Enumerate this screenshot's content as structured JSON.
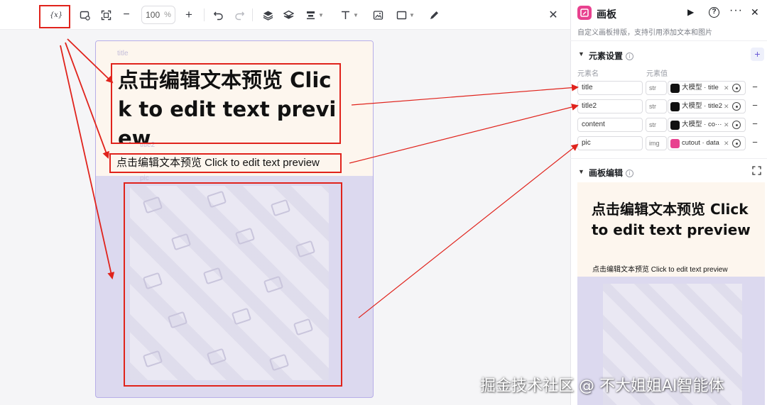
{
  "toolbar": {
    "variable_label": "{x}",
    "zoom_value": "100",
    "zoom_unit": "%",
    "icons": [
      "variable-icon",
      "add-frame-icon",
      "fit-screen-icon",
      "zoom-out-icon",
      "zoom-in-icon",
      "undo-icon",
      "redo-icon",
      "layer-up-icon",
      "layers-icon",
      "align-icon",
      "text-tool-icon",
      "image-tool-icon",
      "shape-tool-icon",
      "pen-tool-icon",
      "close-icon"
    ]
  },
  "canvas": {
    "title_layer_label": "title",
    "title2_layer_label": "title2",
    "pic_layer_label": "pic",
    "title_text": "点击编辑文本预览 Click to edit text preview",
    "title2_text": "点击编辑文本预览 Click to edit text preview"
  },
  "panel": {
    "title": "画板",
    "description": "自定义画板排版，支持引用添加文本和图片",
    "icon_color": "#e8418f",
    "settings_section": "元素设置",
    "col_name": "元素名",
    "col_value": "元素值",
    "rows": [
      {
        "name": "title",
        "type": "str",
        "value": "大模型 · title"
      },
      {
        "name": "title2",
        "type": "str",
        "value": "大模型 · title2"
      },
      {
        "name": "content",
        "type": "str",
        "value": "大模型 · co···"
      },
      {
        "name": "pic",
        "type": "img",
        "value": "cutout · data"
      }
    ],
    "edit_section": "画板编辑",
    "preview_title": "点击编辑文本预览 Click to edit text preview",
    "preview_title2": "点击编辑文本预览 Click to edit text preview"
  },
  "watermark": "掘金技术社区 @ 不大姐姐AI智能体",
  "colors": {
    "annotation": "#e0231c",
    "frame_border": "#b7aee8",
    "accent": "#6b5bd6"
  }
}
